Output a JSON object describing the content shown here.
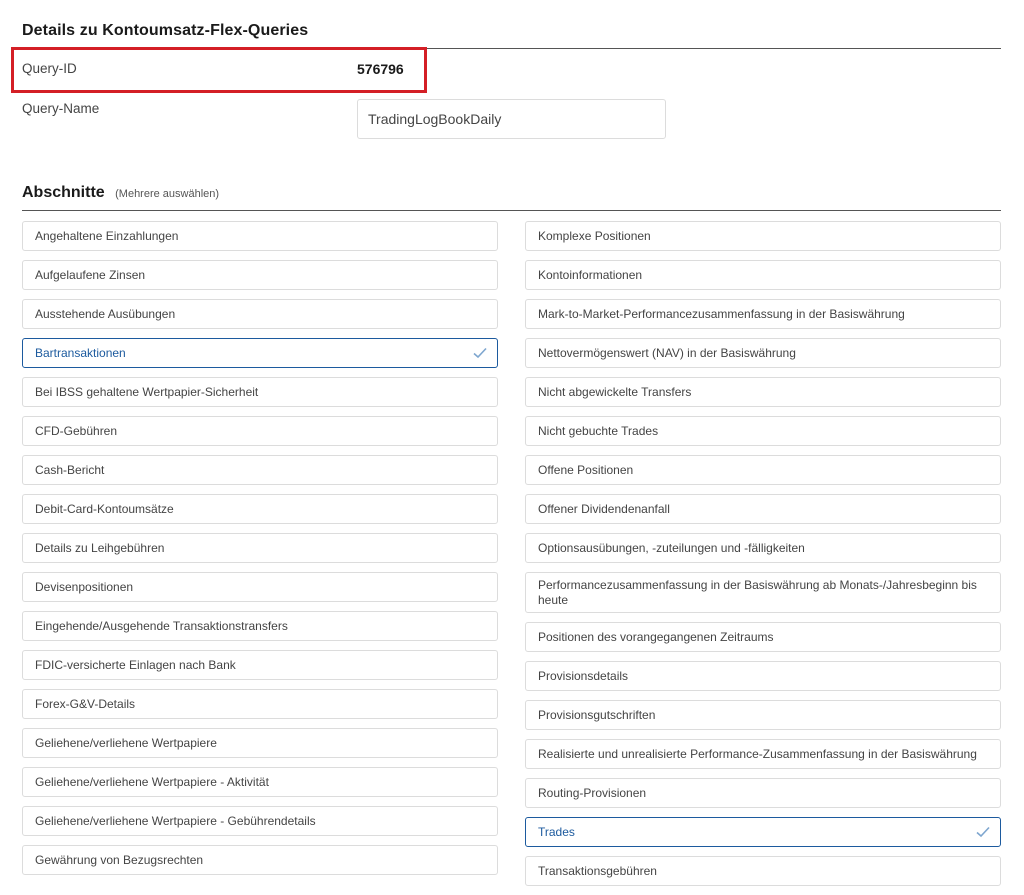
{
  "header": {
    "title": "Details zu Kontoumsatz-Flex-Queries"
  },
  "query": {
    "id_label": "Query-ID",
    "id_value": "576796",
    "name_label": "Query-Name",
    "name_value": "TradingLogBookDaily"
  },
  "sections": {
    "title": "Abschnitte",
    "hint": "(Mehrere auswählen)",
    "left": [
      {
        "label": "Angehaltene Einzahlungen",
        "selected": false
      },
      {
        "label": "Aufgelaufene Zinsen",
        "selected": false
      },
      {
        "label": "Ausstehende Ausübungen",
        "selected": false
      },
      {
        "label": "Bartransaktionen",
        "selected": true
      },
      {
        "label": "Bei IBSS gehaltene Wertpapier-Sicherheit",
        "selected": false
      },
      {
        "label": "CFD-Gebühren",
        "selected": false
      },
      {
        "label": "Cash-Bericht",
        "selected": false
      },
      {
        "label": "Debit-Card-Kontoumsätze",
        "selected": false
      },
      {
        "label": "Details zu Leihgebühren",
        "selected": false
      },
      {
        "label": "Devisenpositionen",
        "selected": false
      },
      {
        "label": "Eingehende/Ausgehende Transaktionstransfers",
        "selected": false
      },
      {
        "label": "FDIC-versicherte Einlagen nach Bank",
        "selected": false
      },
      {
        "label": "Forex-G&V-Details",
        "selected": false
      },
      {
        "label": "Geliehene/verliehene Wertpapiere",
        "selected": false
      },
      {
        "label": "Geliehene/verliehene Wertpapiere - Aktivität",
        "selected": false
      },
      {
        "label": "Geliehene/verliehene Wertpapiere - Gebührendetails",
        "selected": false
      },
      {
        "label": "Gewährung von Bezugsrechten",
        "selected": false
      }
    ],
    "right": [
      {
        "label": "Komplexe Positionen",
        "selected": false
      },
      {
        "label": "Kontoinformationen",
        "selected": false
      },
      {
        "label": "Mark-to-Market-Performancezusammenfassung in der Basiswährung",
        "selected": false
      },
      {
        "label": "Nettovermögenswert (NAV) in der Basiswährung",
        "selected": false
      },
      {
        "label": "Nicht abgewickelte Transfers",
        "selected": false
      },
      {
        "label": "Nicht gebuchte Trades",
        "selected": false
      },
      {
        "label": "Offene Positionen",
        "selected": false
      },
      {
        "label": "Offener Dividendenanfall",
        "selected": false
      },
      {
        "label": "Optionsausübungen, -zuteilungen und -fälligkeiten",
        "selected": false
      },
      {
        "label": "Performancezusammenfassung in der Basiswährung ab Monats-/Jahresbeginn bis heute",
        "selected": false
      },
      {
        "label": "Positionen des vorangegangenen Zeitraums",
        "selected": false
      },
      {
        "label": "Provisionsdetails",
        "selected": false
      },
      {
        "label": "Provisionsgutschriften",
        "selected": false
      },
      {
        "label": "Realisierte und unrealisierte Performance-Zusammenfassung in der Basiswährung",
        "selected": false
      },
      {
        "label": "Routing-Provisionen",
        "selected": false
      },
      {
        "label": "Trades",
        "selected": true
      },
      {
        "label": "Transaktionsgebühren",
        "selected": false
      }
    ],
    "check_icon": "checkmark-icon",
    "selected_color": "#1c5a9e",
    "highlight_color": "#d41f26"
  }
}
